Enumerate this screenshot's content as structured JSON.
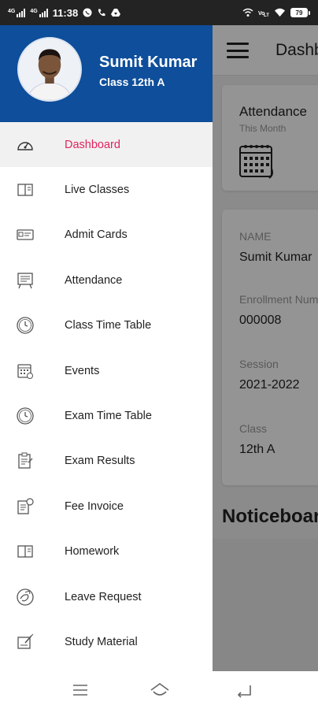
{
  "status_bar": {
    "network_1": "4G",
    "network_2": "4G",
    "time": "11:38",
    "battery_level": "79",
    "icons": [
      "whatsapp-icon",
      "call-icon",
      "drive-icon",
      "vowifi-icon",
      "volte-icon",
      "wifi-icon"
    ]
  },
  "drawer": {
    "user_name": "Sumit Kumar",
    "user_class": "Class 12th A",
    "header_color": "#0e4e9b",
    "active_color": "#e0245e",
    "items": [
      {
        "label": "Dashboard",
        "icon": "gauge-icon"
      },
      {
        "label": "Live Classes",
        "icon": "book-icon"
      },
      {
        "label": "Admit Cards",
        "icon": "id-card-icon"
      },
      {
        "label": "Attendance",
        "icon": "attendance-board-icon"
      },
      {
        "label": "Class Time Table",
        "icon": "clock-icon"
      },
      {
        "label": "Events",
        "icon": "calendar-icon"
      },
      {
        "label": "Exam Time Table",
        "icon": "clock-icon"
      },
      {
        "label": "Exam Results",
        "icon": "clipboard-icon"
      },
      {
        "label": "Fee Invoice",
        "icon": "invoice-icon"
      },
      {
        "label": "Homework",
        "icon": "book-icon"
      },
      {
        "label": "Leave Request",
        "icon": "leave-icon"
      },
      {
        "label": "Study Material",
        "icon": "study-material-icon"
      }
    ]
  },
  "app": {
    "title": "Dashboard",
    "attendance": {
      "title": "Attendance",
      "subtitle": "This Month"
    },
    "profile": {
      "name_label": "NAME",
      "name_value": "Sumit Kumar",
      "enrollment_label": "Enrollment Number",
      "enrollment_value": "000008",
      "session_label": "Session",
      "session_value": "2021-2022",
      "class_label": "Class",
      "class_value": "12th A"
    },
    "noticeboard_title": "Noticeboard"
  },
  "nav_bar": {
    "buttons": [
      "menu-icon",
      "home-icon",
      "back-icon"
    ]
  }
}
